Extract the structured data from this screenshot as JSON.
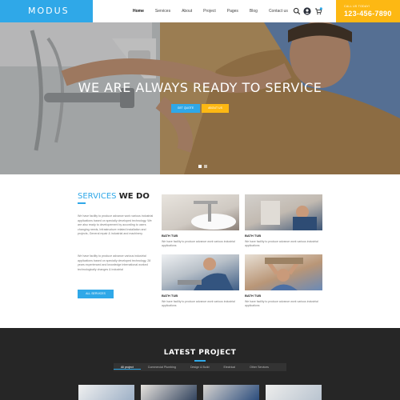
{
  "header": {
    "logo": "MODUS",
    "nav": [
      "Home",
      "Services",
      "About",
      "Project",
      "Pages",
      "Blog",
      "Contact us"
    ],
    "call_label": "CALL US TODAY!",
    "phone": "123-456-7890",
    "icons": [
      "search-icon",
      "user-icon",
      "cart-icon"
    ],
    "colors": {
      "brand": "#2fa8e8",
      "accent": "#fdb813"
    }
  },
  "hero": {
    "title": "WE ARE ALWAYS READY TO SERVICE",
    "btn_quote": "GET QUOTE",
    "btn_about": "ABOUT US",
    "slide_active": 1,
    "slide_count": 2
  },
  "services": {
    "title_part1": "SERVICES",
    "title_part2": "WE DO",
    "para1": "We have facility to produce advance work various industrial applications based on specially developed technology. We are also ready to developement by according to users changing needs, Infrastructure related installation and projects, General repair & industrial and machinery.",
    "para2": "We have facility to produce advance various industrial applications based on specially developed technology, 28 years experienced and knowledge international worked technologically changes & industrial",
    "all_button": "ALL SERVICES",
    "cards": [
      {
        "title": "BATH TUB",
        "desc": "We have facility to produce advance work various industrial applications"
      },
      {
        "title": "BATH TUB",
        "desc": "We have facility to produce advance work various industrial applications"
      },
      {
        "title": "BATH TUB",
        "desc": "We have facility to produce advance work various industrial applications"
      },
      {
        "title": "BATH TUB",
        "desc": "We have facility to produce advance work various industrial applications"
      }
    ]
  },
  "projects": {
    "title": "LATEST PROJECT",
    "tabs": [
      "All project",
      "Commercial Plumbing",
      "Design & Build",
      "Electrical",
      "Other Services"
    ],
    "active_tab": 0
  }
}
